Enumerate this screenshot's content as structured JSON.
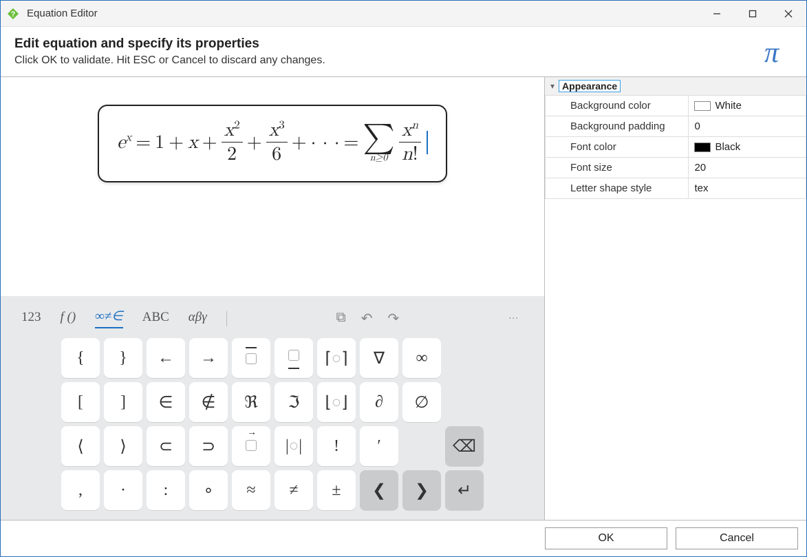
{
  "window": {
    "title": "Equation Editor",
    "minimize_tip": "Minimize",
    "maximize_tip": "Maximize",
    "close_tip": "Close"
  },
  "header": {
    "heading": "Edit equation and specify its properties",
    "subheading": "Click OK to validate. Hit ESC or Cancel to discard any changes.",
    "pi_glyph": "π"
  },
  "equation": {
    "e": "e",
    "x": "x",
    "eq": "=",
    "one": "1",
    "plus": "+",
    "two": "2",
    "three": "3",
    "six": "6",
    "dots": "· · ·",
    "sigma": "∑",
    "sub": "n≥0",
    "n": "n",
    "bang": "!",
    "sup2": "2",
    "sup3": "3",
    "supn": "n"
  },
  "keyboard": {
    "tabs": {
      "numbers": "123",
      "functions": "f ()",
      "symbols": "∞≠∈",
      "latin": "ABC",
      "greek": "αβγ"
    },
    "tools": {
      "copy": "⧉",
      "undo": "↶",
      "redo": "↷"
    },
    "rows": [
      [
        "{",
        "}",
        "←",
        "→",
        "overbox",
        "underbox",
        "⌈○⌉",
        "∇",
        "∞",
        ""
      ],
      [
        "[",
        "]",
        "∈",
        "∉",
        "ℜ",
        "ℑ",
        "⌊○⌋",
        "∂",
        "∅",
        ""
      ],
      [
        "⟨",
        "⟩",
        "⊂",
        "⊃",
        "vecbox",
        "|○|",
        "!",
        "′",
        "",
        "backspace"
      ],
      [
        ",",
        "·",
        ":",
        "∘",
        "≈",
        "≠",
        "±",
        "left",
        "right",
        "enter"
      ]
    ],
    "glyph_labels": {
      "backspace": "⌫",
      "left": "❮",
      "right": "❯",
      "enter": "↵",
      "overbox": "▫",
      "underbox": "▫",
      "vecbox": "▫"
    }
  },
  "properties": {
    "section": "Appearance",
    "rows": [
      {
        "label": "Background color",
        "value": "White",
        "swatch": "white"
      },
      {
        "label": "Background padding",
        "value": "0"
      },
      {
        "label": "Font color",
        "value": "Black",
        "swatch": "black"
      },
      {
        "label": "Font size",
        "value": "20"
      },
      {
        "label": "Letter shape style",
        "value": "tex"
      }
    ]
  },
  "buttons": {
    "ok": "OK",
    "cancel": "Cancel"
  }
}
